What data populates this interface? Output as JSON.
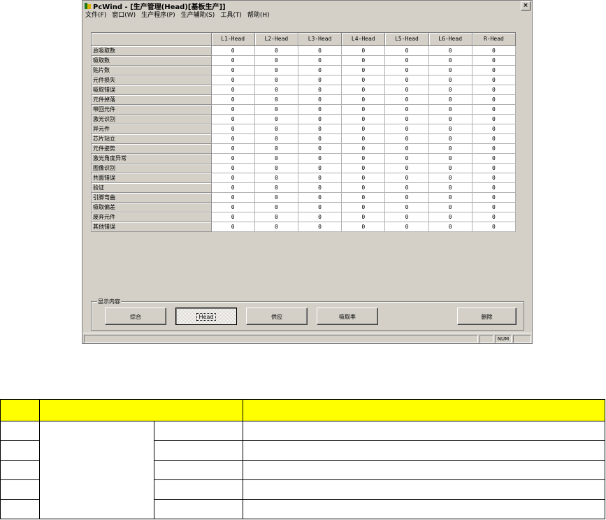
{
  "window": {
    "title": "PcWind - [生产管理(Head)[基板生产]]",
    "close_glyph": "×"
  },
  "menu": [
    {
      "label": "文件(F)"
    },
    {
      "label": "窗口(W)"
    },
    {
      "label": "生产程序(P)"
    },
    {
      "label": "生产辅助(S)"
    },
    {
      "label": "工具(T)"
    },
    {
      "label": "帮助(H)"
    }
  ],
  "grid": {
    "columns": [
      "L1-Head",
      "L2-Head",
      "L3-Head",
      "L4-Head",
      "L5-Head",
      "L6-Head",
      "R-Head"
    ],
    "rows": [
      {
        "label": "总吸取数",
        "values": [
          "0",
          "0",
          "0",
          "0",
          "0",
          "0",
          "0"
        ]
      },
      {
        "label": "吸取数",
        "values": [
          "0",
          "0",
          "0",
          "0",
          "0",
          "0",
          "0"
        ]
      },
      {
        "label": "贴片数",
        "values": [
          "0",
          "0",
          "0",
          "0",
          "0",
          "0",
          "0"
        ]
      },
      {
        "label": "元件损失",
        "values": [
          "0",
          "0",
          "0",
          "0",
          "0",
          "0",
          "0"
        ]
      },
      {
        "label": "吸取错误",
        "values": [
          "0",
          "0",
          "0",
          "0",
          "0",
          "0",
          "0"
        ]
      },
      {
        "label": "元件掉落",
        "values": [
          "0",
          "0",
          "0",
          "0",
          "0",
          "0",
          "0"
        ]
      },
      {
        "label": "带回元件",
        "values": [
          "0",
          "0",
          "0",
          "0",
          "0",
          "0",
          "0"
        ]
      },
      {
        "label": "激光识别",
        "values": [
          "0",
          "0",
          "0",
          "0",
          "0",
          "0",
          "0"
        ]
      },
      {
        "label": "异元件",
        "values": [
          "0",
          "0",
          "0",
          "0",
          "0",
          "0",
          "0"
        ]
      },
      {
        "label": "芯片站立",
        "values": [
          "0",
          "0",
          "0",
          "0",
          "0",
          "0",
          "0"
        ]
      },
      {
        "label": "元件姿势",
        "values": [
          "0",
          "0",
          "0",
          "0",
          "0",
          "0",
          "0"
        ]
      },
      {
        "label": "激光角度异常",
        "values": [
          "0",
          "0",
          "0",
          "0",
          "0",
          "0",
          "0"
        ]
      },
      {
        "label": "图像识别",
        "values": [
          "0",
          "0",
          "0",
          "0",
          "0",
          "0",
          "0"
        ]
      },
      {
        "label": "共面错误",
        "values": [
          "0",
          "0",
          "0",
          "0",
          "0",
          "0",
          "0"
        ]
      },
      {
        "label": "验证",
        "values": [
          "0",
          "0",
          "0",
          "0",
          "0",
          "0",
          "0"
        ]
      },
      {
        "label": "引脚弯曲",
        "values": [
          "0",
          "0",
          "0",
          "0",
          "0",
          "0",
          "0"
        ]
      },
      {
        "label": "吸取偏差",
        "values": [
          "0",
          "0",
          "0",
          "0",
          "0",
          "0",
          "0"
        ]
      },
      {
        "label": "废弃元件",
        "values": [
          "0",
          "0",
          "0",
          "0",
          "0",
          "0",
          "0"
        ]
      },
      {
        "label": "其他错误",
        "values": [
          "0",
          "0",
          "0",
          "0",
          "0",
          "0",
          "0"
        ]
      }
    ]
  },
  "display_group": {
    "label": "显示内容",
    "buttons": [
      {
        "label": "综合",
        "selected": false
      },
      {
        "label": "Head",
        "selected": true
      },
      {
        "label": "供应",
        "selected": false
      },
      {
        "label": "吸取率",
        "selected": false
      }
    ],
    "delete_label": "删除"
  },
  "statusbar": {
    "mode": "NUM"
  }
}
